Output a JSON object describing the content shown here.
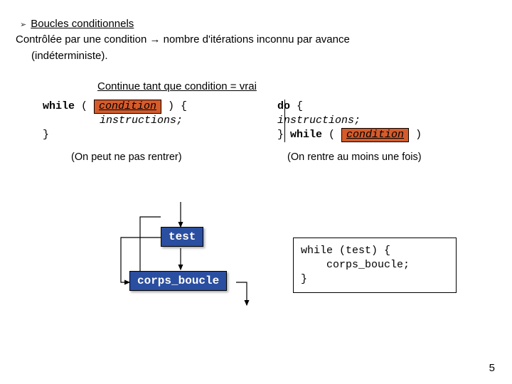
{
  "header": {
    "bullet_icon": "➢",
    "title": "Boucles conditionnels",
    "line2_a": "Contrôlée par une condition ",
    "line2_arrow": "→",
    "line2_b": " nombre d'itérations inconnu par avance",
    "line3": "(indéterministe)."
  },
  "section_title": "Continue tant que condition = vrai",
  "while_block": {
    "w": "while",
    "open": " ( ",
    "cond": "condition",
    "close": " ) {",
    "instr": "instructions;",
    "end": "}",
    "caption": "(On peut ne pas rentrer)"
  },
  "do_block": {
    "do": "do",
    "brace": " {",
    "instr": "instructions;",
    "end_a": "} ",
    "w": "while",
    "open": " ( ",
    "cond": "condition",
    "close": " )",
    "caption": "(On rentre au moins une fois)"
  },
  "diagram": {
    "test": "test",
    "body": "corps_boucle"
  },
  "codebox": {
    "l1": "while (test) {",
    "l2": "    corps_boucle;",
    "l3": "}"
  },
  "page": "5"
}
